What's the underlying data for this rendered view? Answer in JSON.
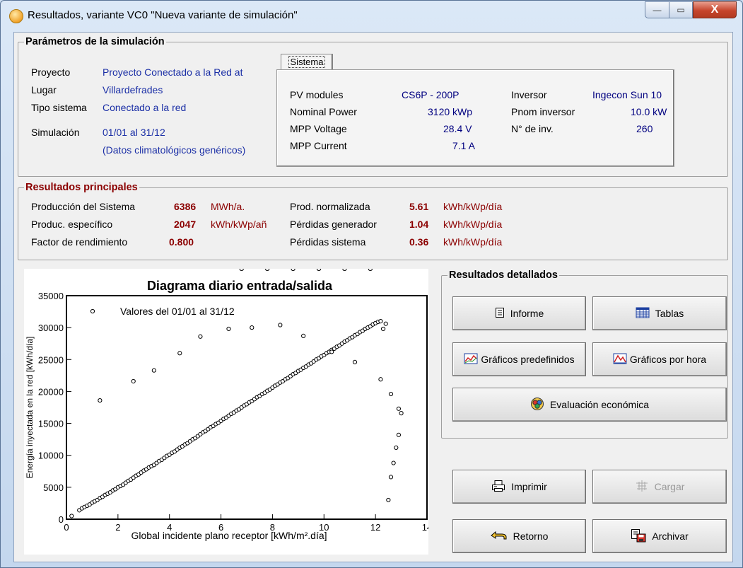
{
  "window": {
    "title": "Resultados, variante VC0  \"Nueva variante de simulación\"",
    "minimize": "—",
    "maximize": "▭",
    "close": "X"
  },
  "params": {
    "legend": "Parámetros de la simulación",
    "proyecto_label": "Proyecto",
    "proyecto_value": "Proyecto Conectado a la Red at",
    "lugar_label": "Lugar",
    "lugar_value": "Villardefrades",
    "tipo_label": "Tipo sistema",
    "tipo_value": "Conectado a la red",
    "sim_label": "Simulación",
    "sim_value": "01/01 al 31/12",
    "sim_note": "(Datos climatológicos genéricos)"
  },
  "sistema_tab": {
    "tab_label": "Sistema",
    "pv_modules_label": "PV modules",
    "pv_modules_value": "CS6P - 200P",
    "nominal_power_label": "Nominal Power",
    "nominal_power_value": "3120 kWp",
    "mpp_voltage_label": "MPP Voltage",
    "mpp_voltage_value": "28.4  V",
    "mpp_current_label": "MPP Current",
    "mpp_current_value": "7.1  A",
    "inversor_label": "Inversor",
    "inversor_value": "Ingecon Sun 10",
    "pnom_label": "Pnom inversor",
    "pnom_value": "10.0  kW",
    "ninv_label": "N° de inv.",
    "ninv_value": "260"
  },
  "results": {
    "legend": "Resultados principales",
    "prod_label": "Producción del Sistema",
    "prod_value": "6386",
    "prod_unit": "MWh/a.",
    "spec_label": "Produc. específico",
    "spec_value": "2047",
    "spec_unit": "kWh/kWp/añ",
    "pr_label": "Factor de rendimiento",
    "pr_value": "0.800",
    "norm_label": "Prod. normalizada",
    "norm_value": "5.61",
    "norm_unit": "kWh/kWp/día",
    "gen_loss_label": "Pérdidas generador",
    "gen_loss_value": "1.04",
    "gen_loss_unit": "kWh/kWp/día",
    "sys_loss_label": "Pérdidas sistema",
    "sys_loss_value": "0.36",
    "sys_loss_unit": "kWh/kWp/día"
  },
  "detailed": {
    "legend": "Resultados detallados",
    "informe": "Informe",
    "tablas": "Tablas",
    "graficos_pre": "Gráficos predefinidos",
    "graficos_hora": "Gráficos por hora",
    "evaluacion": "Evaluación económica"
  },
  "actions": {
    "imprimir": "Imprimir",
    "cargar": "Cargar",
    "retorno": "Retorno",
    "archivar": "Archivar"
  },
  "chart_data": {
    "type": "scatter",
    "title": "Diagrama diario entrada/salida",
    "xlabel": "Global incidente plano receptor [kWh/m².día]",
    "ylabel": "Energía inyectada en la red [kWh/día]",
    "legend": "Valores del 01/01 al 31/12",
    "legend_position": "top-left",
    "xlim": [
      0,
      14
    ],
    "ylim": [
      0,
      35000
    ],
    "xticks": [
      0,
      2,
      4,
      6,
      8,
      10,
      12,
      14
    ],
    "yticks": [
      0,
      5000,
      10000,
      15000,
      20000,
      25000,
      30000,
      35000
    ],
    "grid": false,
    "x": [
      0.2,
      0.5,
      0.6,
      0.7,
      0.8,
      0.9,
      1.0,
      1.1,
      1.2,
      1.3,
      1.4,
      1.5,
      1.6,
      1.7,
      1.8,
      1.9,
      2.0,
      2.1,
      2.2,
      2.3,
      2.4,
      2.5,
      2.6,
      2.7,
      2.8,
      2.9,
      3.0,
      3.1,
      3.2,
      3.3,
      3.4,
      3.5,
      3.6,
      3.7,
      3.8,
      3.9,
      4.0,
      4.1,
      4.2,
      4.3,
      4.4,
      4.5,
      4.6,
      4.7,
      4.8,
      4.9,
      5.0,
      5.1,
      5.2,
      5.3,
      5.4,
      5.5,
      5.6,
      5.7,
      5.8,
      5.9,
      6.0,
      6.1,
      6.2,
      6.3,
      6.4,
      6.5,
      6.6,
      6.7,
      6.8,
      6.9,
      7.0,
      7.1,
      7.2,
      7.3,
      7.4,
      7.5,
      7.6,
      7.7,
      7.8,
      7.9,
      8.0,
      8.1,
      8.2,
      8.3,
      8.4,
      8.5,
      8.6,
      8.7,
      8.8,
      8.9,
      9.0,
      9.1,
      9.2,
      9.3,
      9.4,
      9.5,
      9.6,
      9.7,
      9.8,
      9.9,
      10.0,
      10.1,
      10.2,
      10.3,
      10.4,
      10.5,
      10.6,
      10.7,
      10.8,
      10.9,
      11.0,
      11.1,
      11.2,
      11.3,
      11.4,
      11.5,
      11.6,
      11.7,
      11.8,
      11.9,
      12.0,
      12.1,
      12.2,
      12.3,
      12.4,
      12.5,
      12.6,
      12.7,
      12.8,
      12.9,
      13.0,
      1.3,
      2.6,
      3.4,
      4.4,
      5.2,
      6.3,
      7.2,
      8.3,
      9.2,
      10.3,
      11.2,
      12.2,
      12.6,
      12.9,
      11.8,
      10.8,
      9.8,
      8.8,
      7.8,
      6.8
    ],
    "y": [
      500,
      1400,
      1700,
      1900,
      2100,
      2300,
      2600,
      2800,
      3000,
      3300,
      3500,
      3800,
      4000,
      4200,
      4500,
      4700,
      5000,
      5200,
      5400,
      5700,
      6000,
      6200,
      6500,
      6800,
      7000,
      7300,
      7600,
      7800,
      8100,
      8300,
      8500,
      8800,
      9100,
      9300,
      9600,
      9900,
      10100,
      10400,
      10600,
      10900,
      11200,
      11400,
      11700,
      11900,
      12200,
      12500,
      12700,
      13000,
      13300,
      13600,
      13800,
      14100,
      14400,
      14600,
      14900,
      15100,
      15400,
      15700,
      15900,
      16200,
      16500,
      16700,
      17000,
      17200,
      17500,
      17800,
      18000,
      18300,
      18500,
      18800,
      19100,
      19300,
      19600,
      19800,
      20100,
      20300,
      20600,
      20900,
      21100,
      21400,
      21600,
      21900,
      22100,
      22400,
      22700,
      22900,
      23200,
      23400,
      23700,
      23900,
      24200,
      24400,
      24700,
      25000,
      25200,
      25500,
      25700,
      26000,
      26200,
      26500,
      26700,
      27000,
      27200,
      27500,
      27800,
      28000,
      28300,
      28500,
      28800,
      29000,
      29300,
      29500,
      29800,
      30000,
      30200,
      30500,
      30700,
      30900,
      31000,
      29800,
      30600,
      3000,
      6600,
      8800,
      11200,
      13200,
      16600,
      18600,
      21600,
      23300,
      26000,
      28600,
      29800,
      30000,
      30400,
      28700,
      26200,
      24600,
      21900,
      19600,
      17300
    ]
  }
}
